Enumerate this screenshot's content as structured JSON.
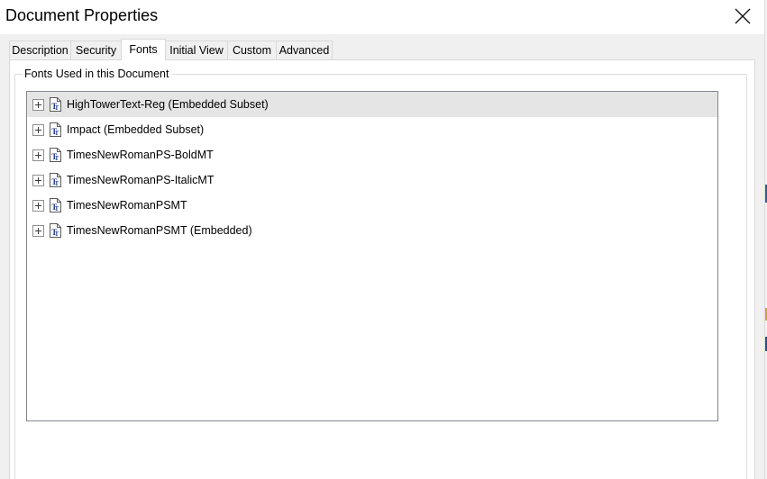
{
  "window": {
    "title": "Document Properties",
    "close_icon": "close-icon"
  },
  "tabs": [
    {
      "label": "Description",
      "active": false
    },
    {
      "label": "Security",
      "active": false
    },
    {
      "label": "Fonts",
      "active": true
    },
    {
      "label": "Initial View",
      "active": false
    },
    {
      "label": "Custom",
      "active": false
    },
    {
      "label": "Advanced",
      "active": false
    }
  ],
  "fonts_panel": {
    "group_label": "Fonts Used in this Document",
    "items": [
      {
        "label": "HighTowerText-Reg (Embedded Subset)",
        "selected": true,
        "expander_icon": "plus-box-icon",
        "icon": "font-file-icon"
      },
      {
        "label": "Impact (Embedded Subset)",
        "selected": false,
        "expander_icon": "plus-box-icon",
        "icon": "font-file-icon"
      },
      {
        "label": "TimesNewRomanPS-BoldMT",
        "selected": false,
        "expander_icon": "plus-box-icon",
        "icon": "font-file-icon"
      },
      {
        "label": "TimesNewRomanPS-ItalicMT",
        "selected": false,
        "expander_icon": "plus-box-icon",
        "icon": "font-file-icon"
      },
      {
        "label": "TimesNewRomanPSMT",
        "selected": false,
        "expander_icon": "plus-box-icon",
        "icon": "font-file-icon"
      },
      {
        "label": "TimesNewRomanPSMT (Embedded)",
        "selected": false,
        "expander_icon": "plus-box-icon",
        "icon": "font-file-icon"
      }
    ]
  },
  "colors": {
    "dialog_background": "#ffffff",
    "panel_background": "#f0f0f0",
    "selected_row": "#e5e5e5",
    "border": "#828790"
  }
}
